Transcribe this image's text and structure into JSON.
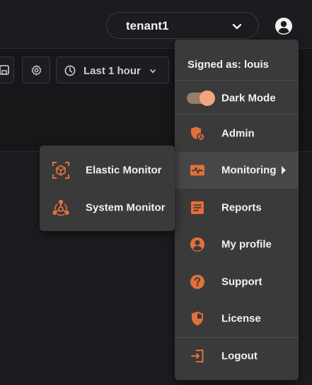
{
  "header": {
    "tenant": "tenant1",
    "icons": {
      "tenant_chevron": "chevron-down-icon",
      "user": "user-circle-icon"
    }
  },
  "toolbar": {
    "time_range": "Last 1 hour",
    "icons": [
      "save-icon",
      "gear-icon",
      "clock-icon",
      "chevron-down-icon"
    ]
  },
  "user_menu": {
    "signed_as": "Signed as: louis",
    "dark_mode": {
      "label": "Dark Mode",
      "enabled": true
    },
    "items": [
      {
        "label": "Admin",
        "icon": "admin-shield-icon"
      },
      {
        "label": "Monitoring",
        "icon": "monitoring-pulse-icon",
        "has_submenu": true
      },
      {
        "label": "Reports",
        "icon": "report-icon"
      },
      {
        "label": "My profile",
        "icon": "profile-icon"
      },
      {
        "label": "Support",
        "icon": "help-icon"
      },
      {
        "label": "License",
        "icon": "license-shield-icon"
      }
    ],
    "logout": {
      "label": "Logout",
      "icon": "logout-icon"
    }
  },
  "monitoring_submenu": {
    "items": [
      {
        "label": "Elastic Monitor",
        "icon": "elastic-cube-icon"
      },
      {
        "label": "System Monitor",
        "icon": "system-network-icon"
      }
    ]
  },
  "colors": {
    "accent": "#e2703a",
    "background": "#161719",
    "menu": "#3a3a3a",
    "menu_highlight": "#474747",
    "toggle_knob": "#f0a67e"
  }
}
